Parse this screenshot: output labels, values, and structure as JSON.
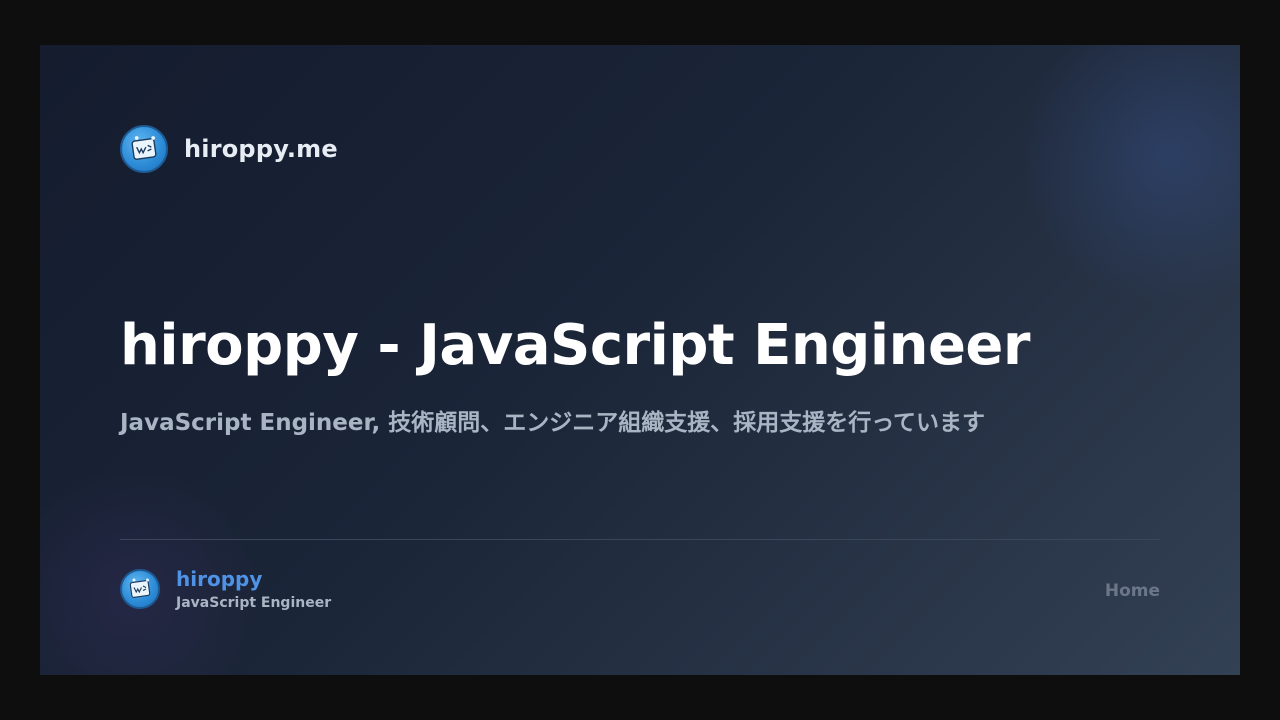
{
  "header": {
    "site_name": "hiroppy.me",
    "logo_icon": "avatar-icon"
  },
  "main": {
    "title": "hiroppy - JavaScript Engineer",
    "subtitle": "JavaScript Engineer, 技術顧問、エンジニア組織支援、採用支援を行っています"
  },
  "footer": {
    "author_name": "hiroppy",
    "author_role": "JavaScript Engineer",
    "home_label": "Home"
  },
  "colors": {
    "background": "#0e0e0e",
    "card_start": "#141c2e",
    "card_end": "#334155",
    "accent": "#4f93e6",
    "title": "#ffffff",
    "muted": "#aab5c4"
  }
}
